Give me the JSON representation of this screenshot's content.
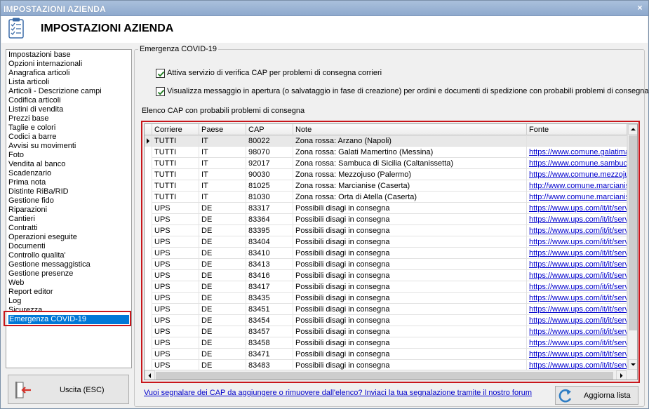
{
  "window": {
    "title": "IMPOSTAZIONI AZIENDA",
    "close": "×"
  },
  "header": {
    "heading": "IMPOSTAZIONI AZIENDA"
  },
  "sidebar": {
    "items": [
      {
        "label": "Impostazioni base"
      },
      {
        "label": "Opzioni internazionali"
      },
      {
        "label": "Anagrafica articoli"
      },
      {
        "label": "Lista articoli"
      },
      {
        "label": "Articoli - Descrizione campi"
      },
      {
        "label": "Codifica articoli"
      },
      {
        "label": "Listini di vendita"
      },
      {
        "label": "Prezzi base"
      },
      {
        "label": "Taglie e colori"
      },
      {
        "label": "Codici a barre"
      },
      {
        "label": "Avvisi su movimenti"
      },
      {
        "label": "Foto"
      },
      {
        "label": "Vendita al banco"
      },
      {
        "label": "Scadenzario"
      },
      {
        "label": "Prima nota"
      },
      {
        "label": "Distinte RiBa/RID"
      },
      {
        "label": "Gestione fido"
      },
      {
        "label": "Riparazioni"
      },
      {
        "label": "Cantieri"
      },
      {
        "label": "Contratti"
      },
      {
        "label": "Operazioni eseguite"
      },
      {
        "label": "Documenti"
      },
      {
        "label": "Controllo qualita'"
      },
      {
        "label": "Gestione messaggistica"
      },
      {
        "label": "Gestione presenze"
      },
      {
        "label": "Web"
      },
      {
        "label": "Report editor"
      },
      {
        "label": "Log"
      },
      {
        "label": "Sicurezza"
      },
      {
        "label": "Emergenza COVID-19",
        "selected": true
      }
    ],
    "exit_label": "Uscita (ESC)"
  },
  "panel": {
    "group_title": "Emergenza COVID-19",
    "check1": {
      "label": "Attiva servizio di verifica CAP per problemi di consegna corrieri",
      "checked": true
    },
    "check2": {
      "label": "Visualizza messaggio in apertura (o salvataggio in fase di creazione) per ordini e documenti di spedizione con probabili problemi di consegna",
      "checked": true
    },
    "list_label": "Elenco CAP con probabili problemi di consegna",
    "columns": [
      "Corriere",
      "Paese",
      "CAP",
      "Note",
      "Fonte"
    ],
    "rows": [
      [
        "TUTTI",
        "IT",
        "80022",
        "Zona rossa: Arzano (Napoli)",
        ""
      ],
      [
        "TUTTI",
        "IT",
        "98070",
        "Zona rossa: Galati Mamertino (Messina)",
        "https://www.comune.galatimamertino.me.it"
      ],
      [
        "TUTTI",
        "IT",
        "92017",
        "Zona rossa: Sambuca di Sicilia (Caltanissetta)",
        "https://www.comune.sambucadisicilia.ag.it"
      ],
      [
        "TUTTI",
        "IT",
        "90030",
        "Zona rossa: Mezzojuso (Palermo)",
        "https://www.comune.mezzojuso.pa.it"
      ],
      [
        "TUTTI",
        "IT",
        "81025",
        "Zona rossa: Marcianise (Caserta)",
        "http://www.comune.marcianise.ce.it"
      ],
      [
        "TUTTI",
        "IT",
        "81030",
        "Zona rossa: Orta di Atella (Caserta)",
        "http://www.comune.marcianise.ce.it"
      ],
      [
        "UPS",
        "DE",
        "83317",
        "Possibili disagi in consegna",
        "https://www.ups.com/it/it/service-alerts"
      ],
      [
        "UPS",
        "DE",
        "83364",
        "Possibili disagi in consegna",
        "https://www.ups.com/it/it/service-alerts"
      ],
      [
        "UPS",
        "DE",
        "83395",
        "Possibili disagi in consegna",
        "https://www.ups.com/it/it/service-alerts"
      ],
      [
        "UPS",
        "DE",
        "83404",
        "Possibili disagi in consegna",
        "https://www.ups.com/it/it/service-alerts"
      ],
      [
        "UPS",
        "DE",
        "83410",
        "Possibili disagi in consegna",
        "https://www.ups.com/it/it/service-alerts"
      ],
      [
        "UPS",
        "DE",
        "83413",
        "Possibili disagi in consegna",
        "https://www.ups.com/it/it/service-alerts"
      ],
      [
        "UPS",
        "DE",
        "83416",
        "Possibili disagi in consegna",
        "https://www.ups.com/it/it/service-alerts"
      ],
      [
        "UPS",
        "DE",
        "83417",
        "Possibili disagi in consegna",
        "https://www.ups.com/it/it/service-alerts"
      ],
      [
        "UPS",
        "DE",
        "83435",
        "Possibili disagi in consegna",
        "https://www.ups.com/it/it/service-alerts"
      ],
      [
        "UPS",
        "DE",
        "83451",
        "Possibili disagi in consegna",
        "https://www.ups.com/it/it/service-alerts"
      ],
      [
        "UPS",
        "DE",
        "83454",
        "Possibili disagi in consegna",
        "https://www.ups.com/it/it/service-alerts"
      ],
      [
        "UPS",
        "DE",
        "83457",
        "Possibili disagi in consegna",
        "https://www.ups.com/it/it/service-alerts"
      ],
      [
        "UPS",
        "DE",
        "83458",
        "Possibili disagi in consegna",
        "https://www.ups.com/it/it/service-alerts"
      ],
      [
        "UPS",
        "DE",
        "83471",
        "Possibili disagi in consegna",
        "https://www.ups.com/it/it/service-alerts"
      ],
      [
        "UPS",
        "DE",
        "83483",
        "Possibili disagi in consegna",
        "https://www.ups.com/it/it/service-alerts"
      ]
    ],
    "report_link": "Vuoi segnalare dei CAP da aggiungere o rimuovere dall'elenco? Inviaci la tua segnalazione tramite il nostro forum",
    "refresh_label": "Aggiorna lista"
  },
  "colors": {
    "accent": "#0078d7",
    "highlight_frame": "#c8161b",
    "link": "#0000cc"
  },
  "icons": [
    "clipboard-checklist-icon",
    "exit-door-icon",
    "refresh-icon",
    "checkmark-icon",
    "row-pointer-icon"
  ]
}
